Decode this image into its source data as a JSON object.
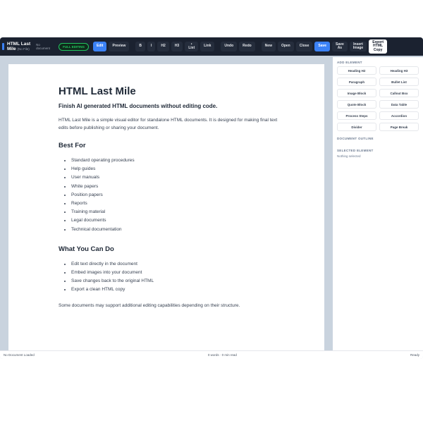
{
  "app": {
    "brand_line1": "HTML Last",
    "brand_line2": "Mile",
    "brand_file": "(No File)",
    "doc_status": "No document",
    "mode_badge": "FULL EDITING"
  },
  "toolbar": {
    "edit": "Edit",
    "preview": "Preview",
    "bold": "B",
    "italic": "I",
    "h2": "H2",
    "h3": "H3",
    "list_top": "•",
    "list": "List",
    "link": "Link",
    "undo": "Undo",
    "redo": "Redo",
    "new": "New",
    "open": "Open",
    "close": "Close",
    "save": "Save",
    "save_as_1": "Save",
    "save_as_2": "As",
    "insert_image_1": "Insert",
    "insert_image_2": "Image",
    "export_1": "Export",
    "export_2": "HTML",
    "export_3": "Copy"
  },
  "sidebar": {
    "add_element_title": "ADD ELEMENT",
    "elements": [
      "Heading H2",
      "Heading H3",
      "Paragraph",
      "Bullet List",
      "Image Block",
      "Callout Box",
      "Quote Block",
      "Data Table",
      "Process Steps",
      "Accordion",
      "Divider",
      "Page Break"
    ],
    "outline_title": "DOCUMENT OUTLINE",
    "selected_title": "SELECTED ELEMENT",
    "selected_value": "Nothing selected"
  },
  "document": {
    "title": "HTML Last Mile",
    "lead": "Finish AI generated HTML documents without editing code.",
    "intro": "HTML Last Mile is a simple visual editor for standalone HTML documents. It is designed for making final text edits before publishing or sharing your document.",
    "best_for_heading": "Best For",
    "best_for_items": [
      "Standard operating procedures",
      "Help guides",
      "User manuals",
      "White papers",
      "Position papers",
      "Reports",
      "Training material",
      "Legal documents",
      "Technical documentation"
    ],
    "can_do_heading": "What You Can Do",
    "can_do_items": [
      "Edit text directly in the document",
      "Embed images into your document",
      "Save changes back to the original HTML",
      "Export a clean HTML copy"
    ],
    "closing": "Some documents may support additional editing capabilities depending on their structure."
  },
  "status": {
    "left": "No Document Loaded",
    "center": "0 words · 0 min read",
    "right": "Ready"
  },
  "colors": {
    "toolbar_bg": "#1b2230",
    "accent": "#3b82f6",
    "badge": "#22c55e",
    "canvas_bg": "#c9d3de"
  }
}
